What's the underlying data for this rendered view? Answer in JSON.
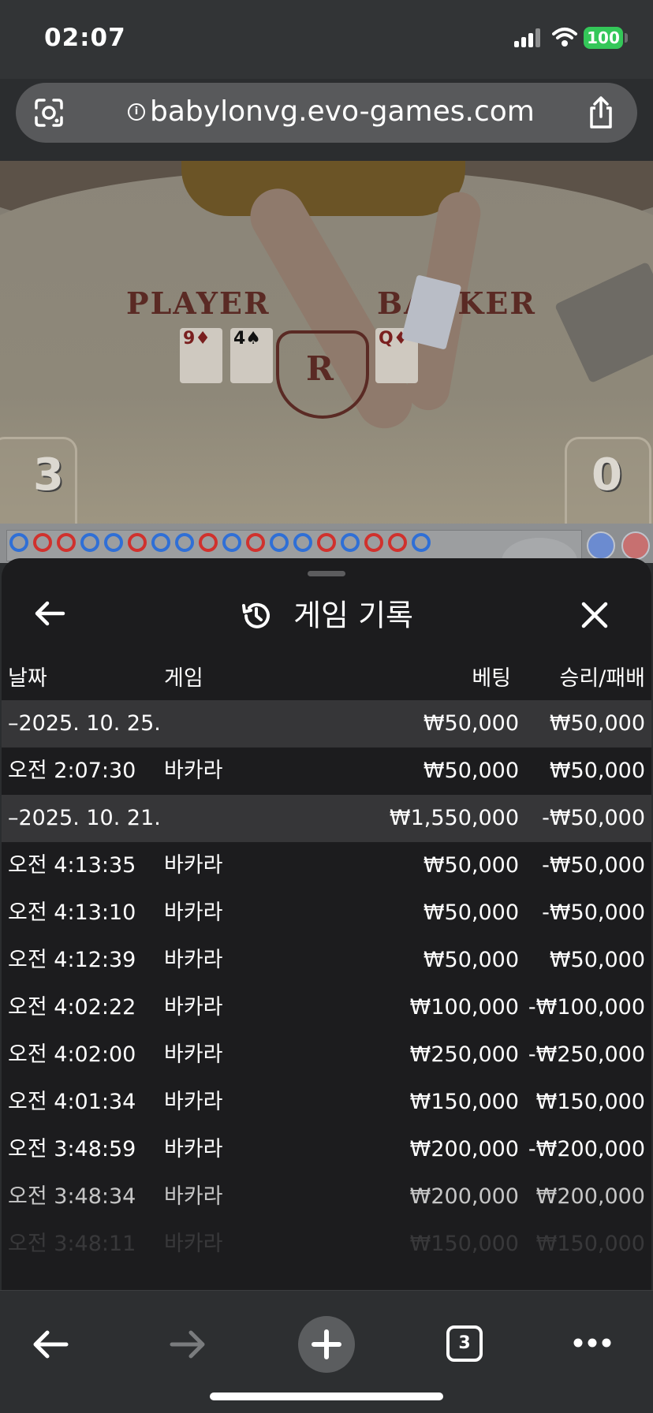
{
  "status": {
    "time": "02:07",
    "battery": "100"
  },
  "browser": {
    "url": "babylonvg.evo-games.com",
    "tab_count": "3",
    "icons": {
      "camera": "lens-camera-icon",
      "site_info": "info-icon",
      "share": "share-icon",
      "back": "back-arrow-icon",
      "forward": "forward-arrow-icon",
      "new_tab": "plus-icon",
      "tabs": "tabs-icon",
      "more": "more-dots-icon"
    }
  },
  "game_view": {
    "player_label": "PLAYER",
    "banker_label": "BANKER",
    "crest_letter": "R",
    "player_score": "3",
    "banker_score": "0",
    "player_cards": [
      "9♦",
      "4♠"
    ],
    "banker_cards": [
      "Q♦"
    ]
  },
  "sheet": {
    "title": "게임 기록",
    "icons": {
      "back": "back-arrow-icon",
      "history": "history-icon",
      "close": "close-icon"
    },
    "columns": {
      "date": "날짜",
      "game": "게임",
      "bet": "베팅",
      "result": "승리/패배"
    },
    "groups": [
      {
        "date": "–2025. 10. 25.",
        "bet_total": "₩50,000",
        "result_total": "₩50,000",
        "rows": [
          {
            "time": "오전 2:07:30",
            "game": "바카라",
            "bet": "₩50,000",
            "result": "₩50,000"
          }
        ]
      },
      {
        "date": "–2025. 10. 21.",
        "bet_total": "₩1,550,000",
        "result_total": "-₩50,000",
        "rows": [
          {
            "time": "오전 4:13:35",
            "game": "바카라",
            "bet": "₩50,000",
            "result": "-₩50,000"
          },
          {
            "time": "오전 4:13:10",
            "game": "바카라",
            "bet": "₩50,000",
            "result": "-₩50,000"
          },
          {
            "time": "오전 4:12:39",
            "game": "바카라",
            "bet": "₩50,000",
            "result": "₩50,000"
          },
          {
            "time": "오전 4:02:22",
            "game": "바카라",
            "bet": "₩100,000",
            "result": "-₩100,000"
          },
          {
            "time": "오전 4:02:00",
            "game": "바카라",
            "bet": "₩250,000",
            "result": "-₩250,000"
          },
          {
            "time": "오전 4:01:34",
            "game": "바카라",
            "bet": "₩150,000",
            "result": "₩150,000"
          },
          {
            "time": "오전 3:48:59",
            "game": "바카라",
            "bet": "₩200,000",
            "result": "-₩200,000"
          },
          {
            "time": "오전 3:48:34",
            "game": "바카라",
            "bet": "₩200,000",
            "result": "₩200,000"
          },
          {
            "time": "오전 3:48:11",
            "game": "바카라",
            "bet": "₩150,000",
            "result": "₩150,000"
          }
        ]
      }
    ]
  },
  "colors": {
    "sheet_bg": "#1c1c1e",
    "group_row_bg": "#363638",
    "battery_green": "#34c759",
    "road_red": "#d0312d",
    "road_blue": "#2f6fd6"
  }
}
